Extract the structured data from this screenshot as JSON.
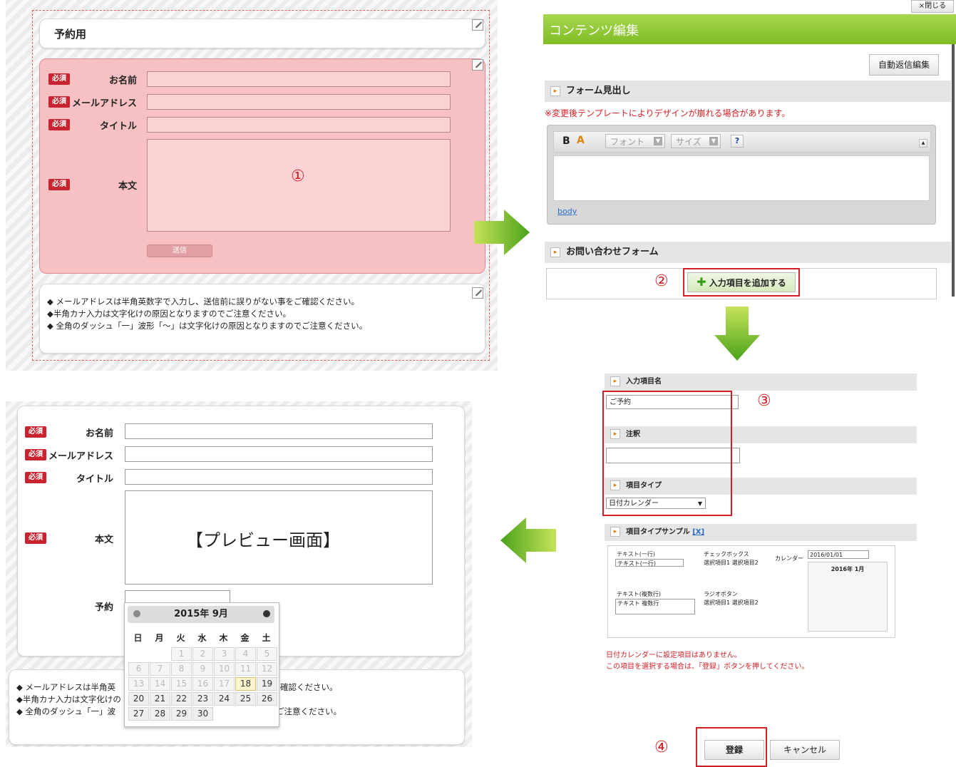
{
  "form_topleft": {
    "title": "予約用",
    "required_badge": "必須",
    "fields": {
      "name": "お名前",
      "email": "メールアドレス",
      "title": "タイトル",
      "body": "本文"
    },
    "step_number": "①",
    "submit_label": "送信",
    "notes": [
      "◆ メールアドレスは半角英数字で入力し、送信前に誤りがない事をご確認ください。",
      "◆半角カナ入力は文字化けの原因となりますのでご注意ください。",
      "◆ 全角のダッシュ「一」波形「～」は文字化けの原因となりますのでご注意ください。"
    ]
  },
  "editor": {
    "close_label": "×閉じる",
    "title": "コンテンツ編集",
    "autoreply_button": "自動返信編集",
    "section_heading": "フォーム見出し",
    "warning": "※変更後テンプレートによりデザインが崩れる場合があります。",
    "toolbar": {
      "bold": "B",
      "color": "A",
      "font": "フォント",
      "size": "サイズ",
      "help": "?"
    },
    "body_link": "body",
    "inquiry_form": "お問い合わせフォーム",
    "step2": "②",
    "add_item_button": "入力項目を追加する"
  },
  "item_settings": {
    "item_name_label": "入力項目名",
    "item_name_value": "ご予約",
    "note_label": "注釈",
    "type_label": "項目タイプ",
    "type_value": "日付カレンダー",
    "step3": "③",
    "sample_label": "項目タイプサンプル",
    "sample_close": "[X]",
    "sample": {
      "text_single": "テキスト(一行)",
      "text_single_value": "テキスト(一行)",
      "checkbox": "チェックボックス",
      "checkbox_items": "選択項目1 選択項目2",
      "calendar_label": "カレンダー",
      "date_value": "2016/01/01",
      "cal_title": "2016年 1月",
      "text_multi": "テキスト(複数行)",
      "text_multi_value": "テキスト 複数行",
      "radio": "ラジオボタン",
      "radio_items": "選択項目1 選択項目2"
    },
    "notice_line1": "日付カレンダーに設定項目はありません。",
    "notice_line2": "この項目を選択する場合は、「登録」ボタンを押してください。",
    "step4": "④",
    "register_button": "登録",
    "cancel_button": "キャンセル"
  },
  "preview": {
    "required_badge": "必須",
    "fields": {
      "name": "お名前",
      "email": "メールアドレス",
      "title": "タイトル",
      "body": "本文",
      "reservation": "予約"
    },
    "body_caption": "【プレビュー画面】",
    "calendar": {
      "title": "2015年 9月",
      "weekdays": [
        "日",
        "月",
        "火",
        "水",
        "木",
        "金",
        "土"
      ],
      "row1": [
        "1",
        "2",
        "3",
        "4",
        "5"
      ],
      "row2": [
        "6",
        "7",
        "8",
        "9",
        "10",
        "11",
        "12"
      ],
      "row3": [
        "13",
        "14",
        "15",
        "16",
        "17",
        "18",
        "19"
      ],
      "row4": [
        "20",
        "21",
        "22",
        "23",
        "24",
        "25",
        "26"
      ],
      "row5": [
        "27",
        "28",
        "29",
        "30"
      ]
    },
    "notes": [
      "◆ メールアドレスは半角英",
      "◆半角カナ入力は文字化けの",
      "◆ 全角のダッシュ「一」波",
      "確認ください。",
      "ご注意ください。"
    ]
  },
  "colors": {
    "green": "#7bbf1e",
    "red": "#d41f26",
    "pink": "#f7c0c3"
  }
}
